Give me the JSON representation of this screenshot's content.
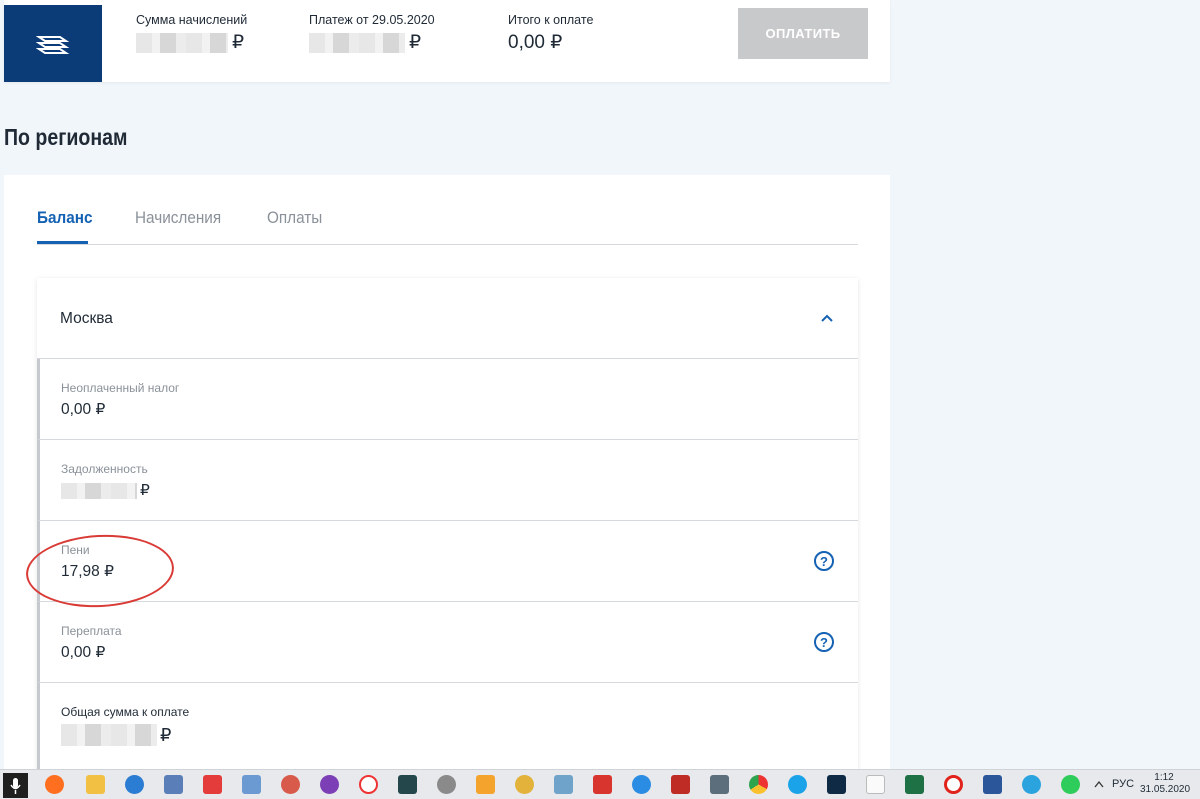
{
  "header": {
    "sum_label": "Сумма начислений",
    "sum_currency": "₽",
    "payment_label": "Платеж от 29.05.2020",
    "payment_currency": "₽",
    "total_label": "Итого к оплате",
    "total_value": "0,00 ₽",
    "pay_button": "ОПЛАТИТЬ"
  },
  "section_title": "По регионам",
  "tabs": [
    {
      "label": "Баланс",
      "active": true
    },
    {
      "label": "Начисления",
      "active": false
    },
    {
      "label": "Оплаты",
      "active": false
    }
  ],
  "region": {
    "name": "Москва",
    "rows": [
      {
        "label": "Неоплаченный налог",
        "value": "0,00 ₽"
      },
      {
        "label": "Задолженность",
        "currency": "₽"
      },
      {
        "label": "Пени",
        "value": "17,98 ₽",
        "help": "?"
      },
      {
        "label": "Переплата",
        "value": "0,00 ₽",
        "help": "?"
      },
      {
        "label": "Общая сумма к оплате",
        "currency": "₽"
      }
    ]
  },
  "taskbar": {
    "language": "РУС",
    "time": "1:12",
    "date": "31.05.2020",
    "icons": [
      "mic-icon",
      "firefox-icon",
      "explorer-icon",
      "edge-icon",
      "app-icon",
      "r-app-icon",
      "desktop-icon",
      "app-icon",
      "tor-icon",
      "yandex-icon",
      "app-icon",
      "app-icon",
      "app-icon",
      "app-icon",
      "app-icon",
      "app-icon",
      "ie-icon",
      "filezilla-icon",
      "app-icon",
      "chrome-icon",
      "skype-icon",
      "photoshop-icon",
      "file-icon",
      "excel-icon",
      "opera-icon",
      "word-icon",
      "telegram-icon",
      "whatsapp-icon"
    ]
  },
  "colors": {
    "accent": "#1562b4",
    "brand_dark": "#0b3c78",
    "annotation": "#d93b36",
    "disabled_button": "#c8c9ca"
  }
}
